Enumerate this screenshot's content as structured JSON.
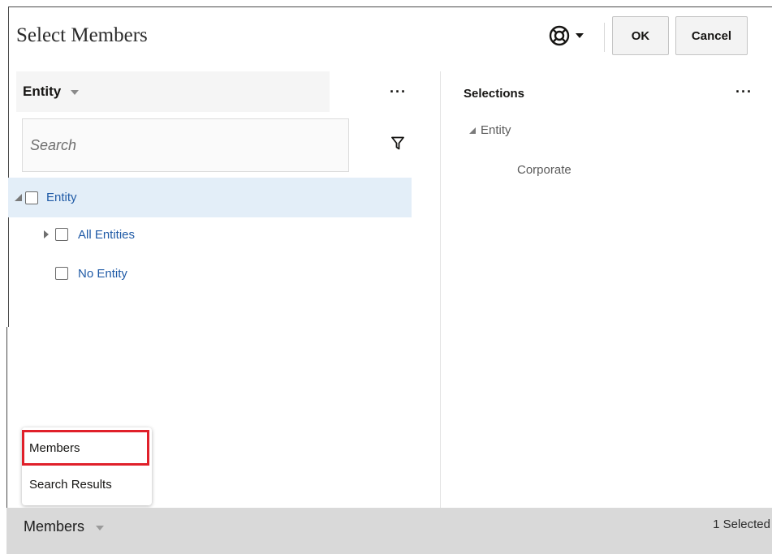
{
  "dialog": {
    "title": "Select Members",
    "help_icon": "lifebuoy-icon",
    "ok_label": "OK",
    "cancel_label": "Cancel"
  },
  "left_panel": {
    "dimension_label": "Entity",
    "more_icon": "more-horizontal-icon",
    "more_label": "···",
    "search": {
      "value": "",
      "placeholder": "Search"
    },
    "filter_icon": "filter-icon",
    "tree": [
      {
        "label": "Entity",
        "expanded": true,
        "selected_row": true,
        "checked": false
      },
      {
        "label": "All Entities",
        "expanded": false,
        "checked": false
      },
      {
        "label": "No Entity",
        "checked": false
      }
    ]
  },
  "right_panel": {
    "heading": "Selections",
    "more_label": "···",
    "group": "Entity",
    "items": [
      "Corporate"
    ]
  },
  "view_menu": {
    "items": [
      {
        "label": "Members",
        "highlighted": true
      },
      {
        "label": "Search Results",
        "highlighted": false
      }
    ]
  },
  "footer": {
    "view_label": "Members",
    "selected_count": "1 Selected"
  },
  "colors": {
    "link_blue": "#1f5aa6",
    "selected_row_bg": "#e3eef8",
    "highlight_border": "#e0202a",
    "footer_bg": "#d9d9d9"
  }
}
